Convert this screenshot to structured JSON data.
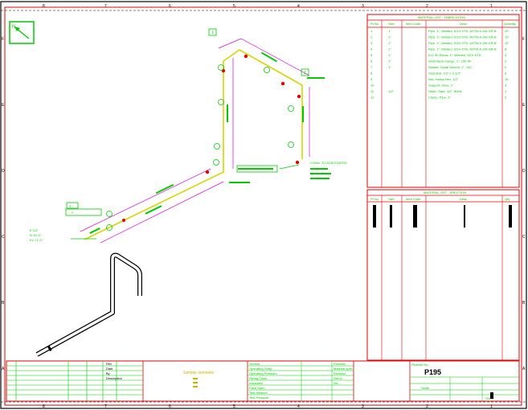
{
  "sheet": {
    "columns_top": [
      "8",
      "7",
      "6",
      "5",
      "4",
      "3",
      "2",
      "1"
    ],
    "rows_side": [
      "F",
      "E",
      "D",
      "C",
      "B",
      "A"
    ],
    "north_marker": "N"
  },
  "pipe_labels": {
    "flag_1": "1",
    "flag_2": "2",
    "flag_3": "3",
    "conn_left": "F",
    "note_right": "CONN. TO ASSOCIATED",
    "elev_start": "E 1/2\"",
    "elev_start_2": "N 10'-0\"",
    "elev_start_3": "EL +1'-0\""
  },
  "bom_fabrication": {
    "title": "MATERIAL LIST - FABRICATION",
    "headers": [
      "Pt No",
      "Size",
      "Item Code",
      "Desc",
      "Quantity"
    ],
    "rows": [
      [
        "1",
        "1\"",
        "",
        "Pipe, 1\", Welded, SCH STD, ASTM A 106 GR B",
        "20'"
      ],
      [
        "2",
        "1\"",
        "",
        "Pipe, 1\", Welded, SCH STD, ASTM A 106 GR B",
        "10'"
      ],
      [
        "3",
        "1\"",
        "",
        "Pipe, 1\", Welded, SCH STD, ASTM A 106 GR B",
        "12'"
      ],
      [
        "4",
        "1\"",
        "",
        "Pipe, 1\", Welded, SCH STD, ASTM A 106 GR B",
        "8'"
      ],
      [
        "5",
        "1\"",
        "",
        "ELL 90 Elbow, 1\", Welded, SCH STD",
        "4"
      ],
      [
        "6",
        "1\"",
        "",
        "Weld Neck Flange, 1\", 150 RF",
        "2"
      ],
      [
        "7",
        "1\"",
        "",
        "Gasket, Spiral Wound, 1\", 150",
        "2"
      ],
      [
        "8",
        "",
        "",
        "Stud Bolt, 1/2\" x 2-1/2\"",
        "8"
      ],
      [
        "9",
        "",
        "",
        "Nut, Heavy Hex, 1/2\"",
        "16"
      ],
      [
        "10",
        "",
        "",
        "Support, Shoe, 1\"",
        "3"
      ],
      [
        "11",
        "1/2\"",
        "",
        "Valve, Gate, 1/2\", 800#",
        "1"
      ],
      [
        "12",
        "",
        "",
        "Clamp, Pipe, 1\"",
        "2"
      ]
    ]
  },
  "bom_erection": {
    "title": "MATERIAL LIST - ERECTION",
    "headers": [
      "Pt No",
      "Size",
      "Item Code",
      "Desc",
      "Qty"
    ]
  },
  "title_block": {
    "drawing_title": "Sample Isometric",
    "rev_headers": [
      "Rev",
      "Date",
      "By",
      "Description"
    ],
    "process_labels": [
      "Service",
      "Operating Temp.",
      "Operating Pressure",
      "Piping Class",
      "Insulation",
      "Paint Spec.",
      "Test Medium",
      "Test Pressure"
    ],
    "process_values": [
      "Process",
      "Material spec",
      "Revision",
      "Rev A",
      "NA",
      "",
      "",
      ""
    ],
    "pipeline_label": "Pipeline No.",
    "pipeline_no": "P195",
    "sheet_label": "Sheet",
    "scale_label": "Scale"
  }
}
